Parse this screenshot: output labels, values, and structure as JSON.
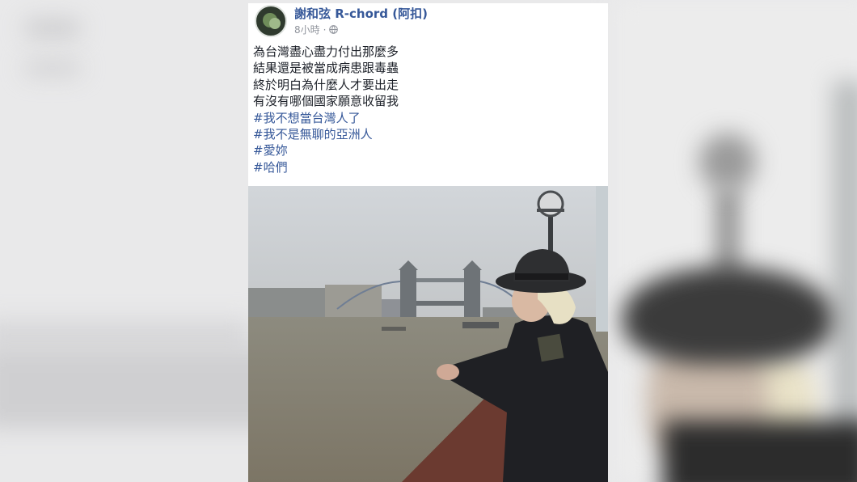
{
  "post": {
    "author": "謝和弦 R-chord (阿扣)",
    "timestamp": "8小時",
    "separator": "·",
    "privacy_icon": "globe-icon",
    "text_lines": [
      "為台灣盡心盡力付出那麼多",
      "結果還是被當成病患跟毒蟲",
      "終於明白為什麼人才要出走",
      "有沒有哪個國家願意收留我"
    ],
    "hashtags": [
      "#我不想當台灣人了",
      "#我不是無聊的亞洲人",
      "#愛妳",
      "#哈們"
    ],
    "photo_icon": "tower-bridge-photo"
  },
  "colors": {
    "link": "#365899",
    "text": "#1d2129",
    "meta": "#90949c",
    "background": "#e9e9ea",
    "card": "#ffffff"
  }
}
